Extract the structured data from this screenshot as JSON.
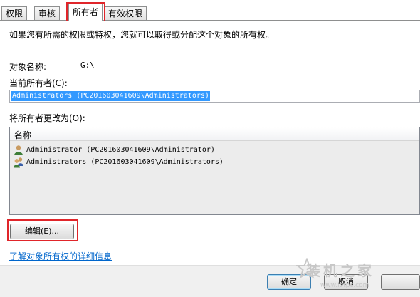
{
  "tabs": [
    {
      "label": "权限"
    },
    {
      "label": "审核"
    },
    {
      "label": "所有者"
    },
    {
      "label": "有效权限"
    }
  ],
  "info_text": "如果您有所需的权限或特权，您就可以取得或分配这个对象的所有权。",
  "object_name": {
    "label": "对象名称:",
    "value": "G:\\"
  },
  "current_owner": {
    "label": "当前所有者(C):",
    "value": "Administrators (PC201603041609\\Administrators)"
  },
  "change_owner": {
    "label": "将所有者更改为(O):",
    "column_header": "名称",
    "items": [
      {
        "label": "Administrator (PC201603041609\\Administrator)",
        "icon": "user-icon"
      },
      {
        "label": "Administrators (PC201603041609\\Administrators)",
        "icon": "user-group-icon"
      }
    ]
  },
  "edit_button": "编辑(E)...",
  "details_link": "了解对象所有权的详细信息",
  "ok_button": "确定",
  "cancel_button": "取消",
  "watermark": {
    "text": "装机之家",
    "url": "www.lotpc.com"
  },
  "colors": {
    "highlight": "#e0252a",
    "selection": "#3399ff",
    "link": "#0066cc"
  }
}
